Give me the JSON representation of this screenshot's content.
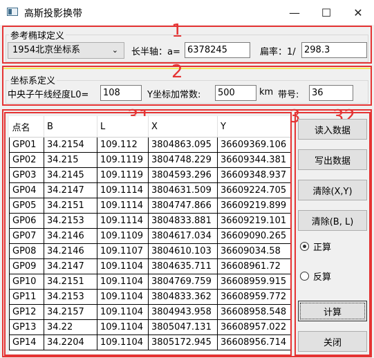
{
  "window": {
    "title": "高斯投影换带",
    "minimize": "—",
    "maximize": "☐",
    "close": "✕"
  },
  "ellipsoid_group": {
    "title": "参考椭球定义",
    "marker": "1",
    "select_value": "1954北京坐标系",
    "semi_major_label": "长半轴：a=",
    "semi_major_value": "6378245",
    "flattening_label": "扁率：1/",
    "flattening_value": "298.3"
  },
  "coord_group": {
    "title": "坐标系定义",
    "marker": "2",
    "central_meridian_label": "中央子午线经度L0=",
    "central_meridian_value": "108",
    "y_offset_label": "Y坐标加常数:",
    "y_offset_value": "500",
    "unit_label": "km",
    "zone_label": "带号:",
    "zone_value": "36"
  },
  "markers": {
    "table": "31",
    "panel": "3",
    "buttons": "32"
  },
  "table": {
    "headers": [
      "点名",
      "B",
      "L",
      "X",
      "Y"
    ],
    "rows": [
      [
        "GP01",
        "34.2154",
        "109.112",
        "3804863.095",
        "36609369.106"
      ],
      [
        "GP02",
        "34.215",
        "109.1119",
        "3804748.229",
        "36609344.381"
      ],
      [
        "GP03",
        "34.2145",
        "109.1119",
        "3804593.296",
        "36609348.937"
      ],
      [
        "GP04",
        "34.2147",
        "109.1114",
        "3804631.509",
        "36609224.705"
      ],
      [
        "GP05",
        "34.2151",
        "109.1114",
        "3804747.866",
        "36609219.899"
      ],
      [
        "GP06",
        "34.2153",
        "109.1114",
        "3804833.881",
        "36609219.101"
      ],
      [
        "GP07",
        "34.2146",
        "109.1109",
        "3804617.034",
        "36609090.265"
      ],
      [
        "GP08",
        "34.2146",
        "109.1107",
        "3804610.103",
        "36609034.58"
      ],
      [
        "GP09",
        "34.2147",
        "109.1104",
        "3804635.711",
        "36608961.72"
      ],
      [
        "GP10",
        "34.2151",
        "109.1104",
        "3804769.759",
        "36608959.915"
      ],
      [
        "GP11",
        "34.2153",
        "109.1104",
        "3804833.362",
        "36608959.772"
      ],
      [
        "GP12",
        "34.2157",
        "109.1104",
        "3804943.958",
        "36608958.548"
      ],
      [
        "GP13",
        "34.22",
        "109.1104",
        "3805047.131",
        "36608957.022"
      ],
      [
        "GP14",
        "34.2204",
        "109.1104",
        "3805172.945",
        "36608956.714"
      ]
    ]
  },
  "buttons": {
    "read": "读入数据",
    "write": "写出数据",
    "clear_xy": "清除(X,Y)",
    "clear_bl": "清除(B, L)",
    "forward": "正算",
    "inverse": "反算",
    "compute": "计算",
    "close": "关闭",
    "selected_mode": "forward"
  },
  "colors": {
    "annotation": "#e53333",
    "highlight": "#f5e85a",
    "background": "#f0f0f0"
  }
}
